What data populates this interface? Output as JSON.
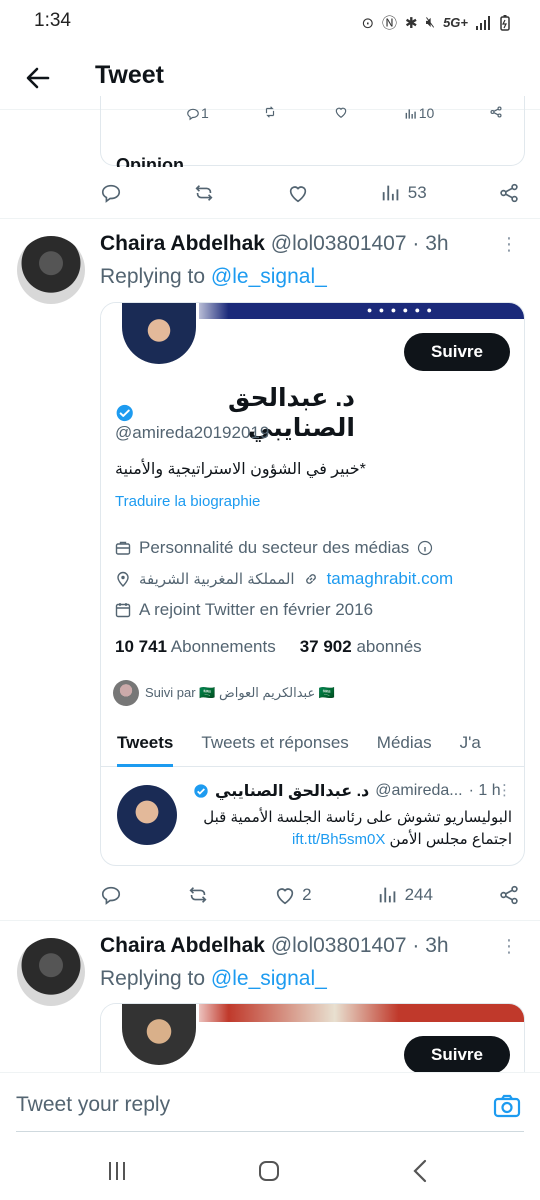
{
  "status_bar": {
    "time": "1:34",
    "network": "5G+"
  },
  "header": {
    "title": "Tweet"
  },
  "prev_tweet": {
    "card_stats": {
      "replies": "1",
      "likes_count": "",
      "views": "10"
    },
    "card_title_partial": "Opinion",
    "views": "53"
  },
  "tweet1": {
    "name": "Chaira Abdelhak",
    "handle": "@lol03801407",
    "time": "· 3h",
    "replying_label": "Replying to",
    "replying_to": "@le_signal_",
    "card": {
      "follow_label": "Suivre",
      "name": "د. عبدالحق الصنايبي",
      "handle": "@amireda20192019",
      "bio": "*خبير في الشؤون الاستراتيجية والأمنية",
      "translate_label": "Traduire la biographie",
      "category": "Personnalité du secteur des médias",
      "location": "المملكة المغربية الشريفة",
      "website": "tamaghrabit.com",
      "joined": "A rejoint Twitter en février 2016",
      "following_count": "10 741",
      "following_label": "Abonnements",
      "followers_count": "37 902",
      "followers_label": "abonnés",
      "followed_by_label": "Suivi par 🇸🇦 عبدالكريم العواض 🇸🇦",
      "tabs": [
        "Tweets",
        "Tweets et réponses",
        "Médias",
        "J'a"
      ],
      "inner_tweet": {
        "name": "د. عبدالحق الصنايبي",
        "handle": "@amireda...",
        "time": "· 1 h",
        "text": "البوليساريو تشوش على رئاسة الجلسة الأممية قبل اجتماع مجلس الأمن",
        "link": "ift.tt/Bh5sm0X"
      }
    },
    "likes": "2",
    "views": "244"
  },
  "tweet2": {
    "name": "Chaira Abdelhak",
    "handle": "@lol03801407",
    "time": "· 3h",
    "replying_label": "Replying to",
    "replying_to": "@le_signal_",
    "follow_label": "Suivre"
  },
  "reply_bar": {
    "placeholder": "Tweet your reply"
  },
  "colors": {
    "accent": "#1d9bf0",
    "text": "#0f1419",
    "muted": "#536471"
  }
}
